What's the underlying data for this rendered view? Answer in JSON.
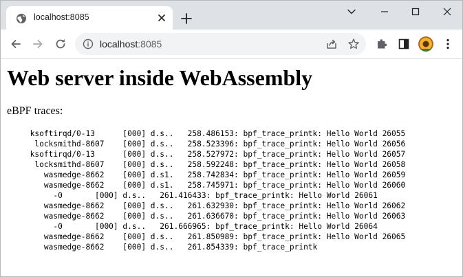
{
  "browser": {
    "tab": {
      "title": "localhost:8085"
    },
    "address_bar": {
      "host": "localhost",
      "port": ":8085"
    }
  },
  "page": {
    "heading": "Web server inside WebAssembly",
    "intro": "eBPF traces:",
    "traces": [
      "     ksoftirqd/0-13      [000] d.s..   258.486153: bpf_trace_printk: Hello World 26055",
      "      locksmithd-8607    [000] d.s..   258.523396: bpf_trace_printk: Hello World 26056",
      "     ksoftirqd/0-13      [000] d.s..   258.527972: bpf_trace_printk: Hello World 26057",
      "      locksmithd-8607    [000] d.s..   258.592248: bpf_trace_printk: Hello World 26058",
      "        wasmedge-8662    [000] d.s1.   258.742834: bpf_trace_printk: Hello World 26059",
      "        wasmedge-8662    [000] d.s1.   258.745971: bpf_trace_printk: Hello World 26060",
      "          -0       [000] d.s..   261.416433: bpf_trace_printk: Hello World 26061",
      "        wasmedge-8662    [000] d.s..   261.632930: bpf_trace_printk: Hello World 26062",
      "        wasmedge-8662    [000] d.s..   261.636670: bpf_trace_printk: Hello World 26063",
      "          -0       [000] d.s..   261.666965: bpf_trace_printk: Hello World 26064",
      "        wasmedge-8662    [000] d.s..   261.850989: bpf_trace_printk: Hello World 26065",
      "        wasmedge-8662    [000] d.s..   261.854339: bpf_trace_printk"
    ]
  },
  "icons": {
    "favicon": "globe-icon",
    "tab_close": "close-icon",
    "new_tab": "plus-icon",
    "tab_search": "chevron-down-icon",
    "minimize": "minimize-icon",
    "maximize": "maximize-icon",
    "close_window": "close-icon",
    "back": "arrow-left-icon",
    "forward": "arrow-right-icon",
    "reload": "reload-icon",
    "site_info": "info-icon",
    "share": "share-icon",
    "bookmark": "star-icon",
    "extensions": "puzzle-icon",
    "side_panel": "side-panel-icon",
    "profile": "avatar",
    "menu": "kebab-menu-icon"
  },
  "colors": {
    "tabstrip_bg": "#dee1e6",
    "omnibox_bg": "#f1f3f4",
    "icon": "#5f6368"
  }
}
